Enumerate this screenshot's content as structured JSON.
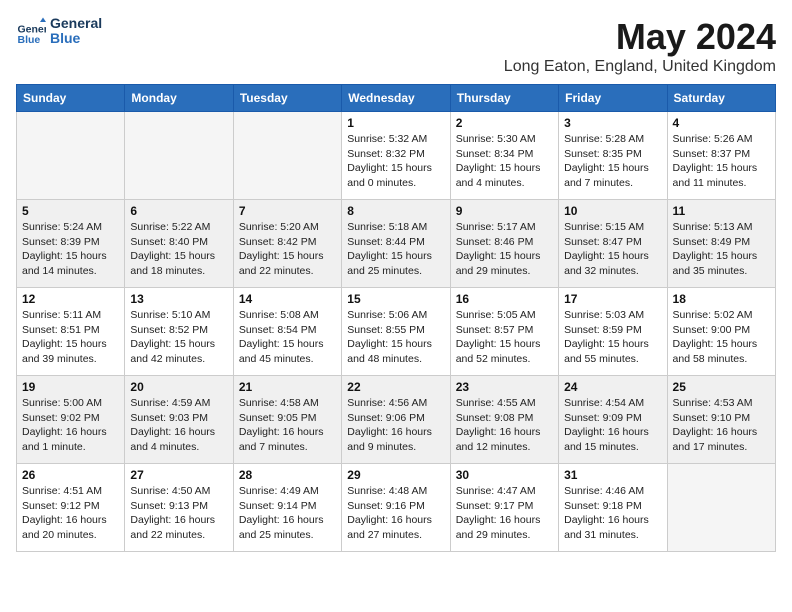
{
  "header": {
    "logo_line1": "General",
    "logo_line2": "Blue",
    "month_title": "May 2024",
    "location": "Long Eaton, England, United Kingdom"
  },
  "days_of_week": [
    "Sunday",
    "Monday",
    "Tuesday",
    "Wednesday",
    "Thursday",
    "Friday",
    "Saturday"
  ],
  "weeks": [
    [
      {
        "day": "",
        "info": ""
      },
      {
        "day": "",
        "info": ""
      },
      {
        "day": "",
        "info": ""
      },
      {
        "day": "1",
        "info": "Sunrise: 5:32 AM\nSunset: 8:32 PM\nDaylight: 15 hours\nand 0 minutes."
      },
      {
        "day": "2",
        "info": "Sunrise: 5:30 AM\nSunset: 8:34 PM\nDaylight: 15 hours\nand 4 minutes."
      },
      {
        "day": "3",
        "info": "Sunrise: 5:28 AM\nSunset: 8:35 PM\nDaylight: 15 hours\nand 7 minutes."
      },
      {
        "day": "4",
        "info": "Sunrise: 5:26 AM\nSunset: 8:37 PM\nDaylight: 15 hours\nand 11 minutes."
      }
    ],
    [
      {
        "day": "5",
        "info": "Sunrise: 5:24 AM\nSunset: 8:39 PM\nDaylight: 15 hours\nand 14 minutes."
      },
      {
        "day": "6",
        "info": "Sunrise: 5:22 AM\nSunset: 8:40 PM\nDaylight: 15 hours\nand 18 minutes."
      },
      {
        "day": "7",
        "info": "Sunrise: 5:20 AM\nSunset: 8:42 PM\nDaylight: 15 hours\nand 22 minutes."
      },
      {
        "day": "8",
        "info": "Sunrise: 5:18 AM\nSunset: 8:44 PM\nDaylight: 15 hours\nand 25 minutes."
      },
      {
        "day": "9",
        "info": "Sunrise: 5:17 AM\nSunset: 8:46 PM\nDaylight: 15 hours\nand 29 minutes."
      },
      {
        "day": "10",
        "info": "Sunrise: 5:15 AM\nSunset: 8:47 PM\nDaylight: 15 hours\nand 32 minutes."
      },
      {
        "day": "11",
        "info": "Sunrise: 5:13 AM\nSunset: 8:49 PM\nDaylight: 15 hours\nand 35 minutes."
      }
    ],
    [
      {
        "day": "12",
        "info": "Sunrise: 5:11 AM\nSunset: 8:51 PM\nDaylight: 15 hours\nand 39 minutes."
      },
      {
        "day": "13",
        "info": "Sunrise: 5:10 AM\nSunset: 8:52 PM\nDaylight: 15 hours\nand 42 minutes."
      },
      {
        "day": "14",
        "info": "Sunrise: 5:08 AM\nSunset: 8:54 PM\nDaylight: 15 hours\nand 45 minutes."
      },
      {
        "day": "15",
        "info": "Sunrise: 5:06 AM\nSunset: 8:55 PM\nDaylight: 15 hours\nand 48 minutes."
      },
      {
        "day": "16",
        "info": "Sunrise: 5:05 AM\nSunset: 8:57 PM\nDaylight: 15 hours\nand 52 minutes."
      },
      {
        "day": "17",
        "info": "Sunrise: 5:03 AM\nSunset: 8:59 PM\nDaylight: 15 hours\nand 55 minutes."
      },
      {
        "day": "18",
        "info": "Sunrise: 5:02 AM\nSunset: 9:00 PM\nDaylight: 15 hours\nand 58 minutes."
      }
    ],
    [
      {
        "day": "19",
        "info": "Sunrise: 5:00 AM\nSunset: 9:02 PM\nDaylight: 16 hours\nand 1 minute."
      },
      {
        "day": "20",
        "info": "Sunrise: 4:59 AM\nSunset: 9:03 PM\nDaylight: 16 hours\nand 4 minutes."
      },
      {
        "day": "21",
        "info": "Sunrise: 4:58 AM\nSunset: 9:05 PM\nDaylight: 16 hours\nand 7 minutes."
      },
      {
        "day": "22",
        "info": "Sunrise: 4:56 AM\nSunset: 9:06 PM\nDaylight: 16 hours\nand 9 minutes."
      },
      {
        "day": "23",
        "info": "Sunrise: 4:55 AM\nSunset: 9:08 PM\nDaylight: 16 hours\nand 12 minutes."
      },
      {
        "day": "24",
        "info": "Sunrise: 4:54 AM\nSunset: 9:09 PM\nDaylight: 16 hours\nand 15 minutes."
      },
      {
        "day": "25",
        "info": "Sunrise: 4:53 AM\nSunset: 9:10 PM\nDaylight: 16 hours\nand 17 minutes."
      }
    ],
    [
      {
        "day": "26",
        "info": "Sunrise: 4:51 AM\nSunset: 9:12 PM\nDaylight: 16 hours\nand 20 minutes."
      },
      {
        "day": "27",
        "info": "Sunrise: 4:50 AM\nSunset: 9:13 PM\nDaylight: 16 hours\nand 22 minutes."
      },
      {
        "day": "28",
        "info": "Sunrise: 4:49 AM\nSunset: 9:14 PM\nDaylight: 16 hours\nand 25 minutes."
      },
      {
        "day": "29",
        "info": "Sunrise: 4:48 AM\nSunset: 9:16 PM\nDaylight: 16 hours\nand 27 minutes."
      },
      {
        "day": "30",
        "info": "Sunrise: 4:47 AM\nSunset: 9:17 PM\nDaylight: 16 hours\nand 29 minutes."
      },
      {
        "day": "31",
        "info": "Sunrise: 4:46 AM\nSunset: 9:18 PM\nDaylight: 16 hours\nand 31 minutes."
      },
      {
        "day": "",
        "info": ""
      }
    ]
  ]
}
